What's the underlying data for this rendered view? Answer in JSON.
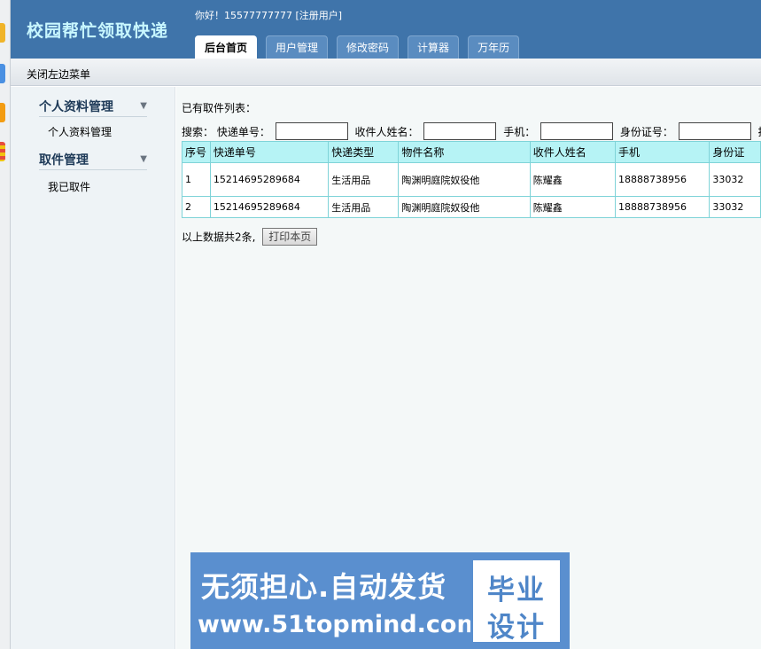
{
  "header": {
    "brand": "校园帮忙领取快递",
    "greeting": "你好！15577777777 [注册用户]",
    "tabs": [
      {
        "label": "后台首页",
        "active": true
      },
      {
        "label": "用户管理"
      },
      {
        "label": "修改密码"
      },
      {
        "label": "计算器"
      },
      {
        "label": "万年历"
      }
    ]
  },
  "subbar": {
    "close_menu": "关闭左边菜单"
  },
  "sidebar": {
    "sections": [
      {
        "title": "个人资料管理",
        "items": [
          "个人资料管理"
        ]
      },
      {
        "title": "取件管理",
        "items": [
          "我已取件"
        ]
      }
    ]
  },
  "main": {
    "list_title": "已有取件列表：",
    "search": {
      "prefix": "搜索：",
      "tracking_label": "快递单号：",
      "recipient_label": "收件人姓名：",
      "phone_label": "手机：",
      "idcard_label": "身份证号：",
      "sort_label": "排序"
    },
    "table": {
      "headers": [
        "序号",
        "快递单号",
        "快递类型",
        "物件名称",
        "收件人姓名",
        "手机",
        "身份证"
      ],
      "rows": [
        [
          "1",
          "15214695289684",
          "生活用品",
          "陶渊明庭院奴役他",
          "陈耀鑫",
          "18888738956",
          "33032"
        ],
        [
          "2",
          "15214695289684",
          "生活用品",
          "陶渊明庭院奴役他",
          "陈耀鑫",
          "18888738956",
          "33032"
        ]
      ]
    },
    "summary": "以上数据共2条,",
    "print_button": "打印本页"
  },
  "banner": {
    "line1": "无须担心.自动发货",
    "line2": "www.51topmind.com",
    "badge_line1": "毕业",
    "badge_line2": "设计"
  },
  "colors": {
    "header_bg": "#3f74aa",
    "brand_text": "#c8f7ff",
    "table_header_bg": "#b6f3f5",
    "table_border": "#7fd3d8",
    "banner_bg": "#5a8fcf"
  }
}
